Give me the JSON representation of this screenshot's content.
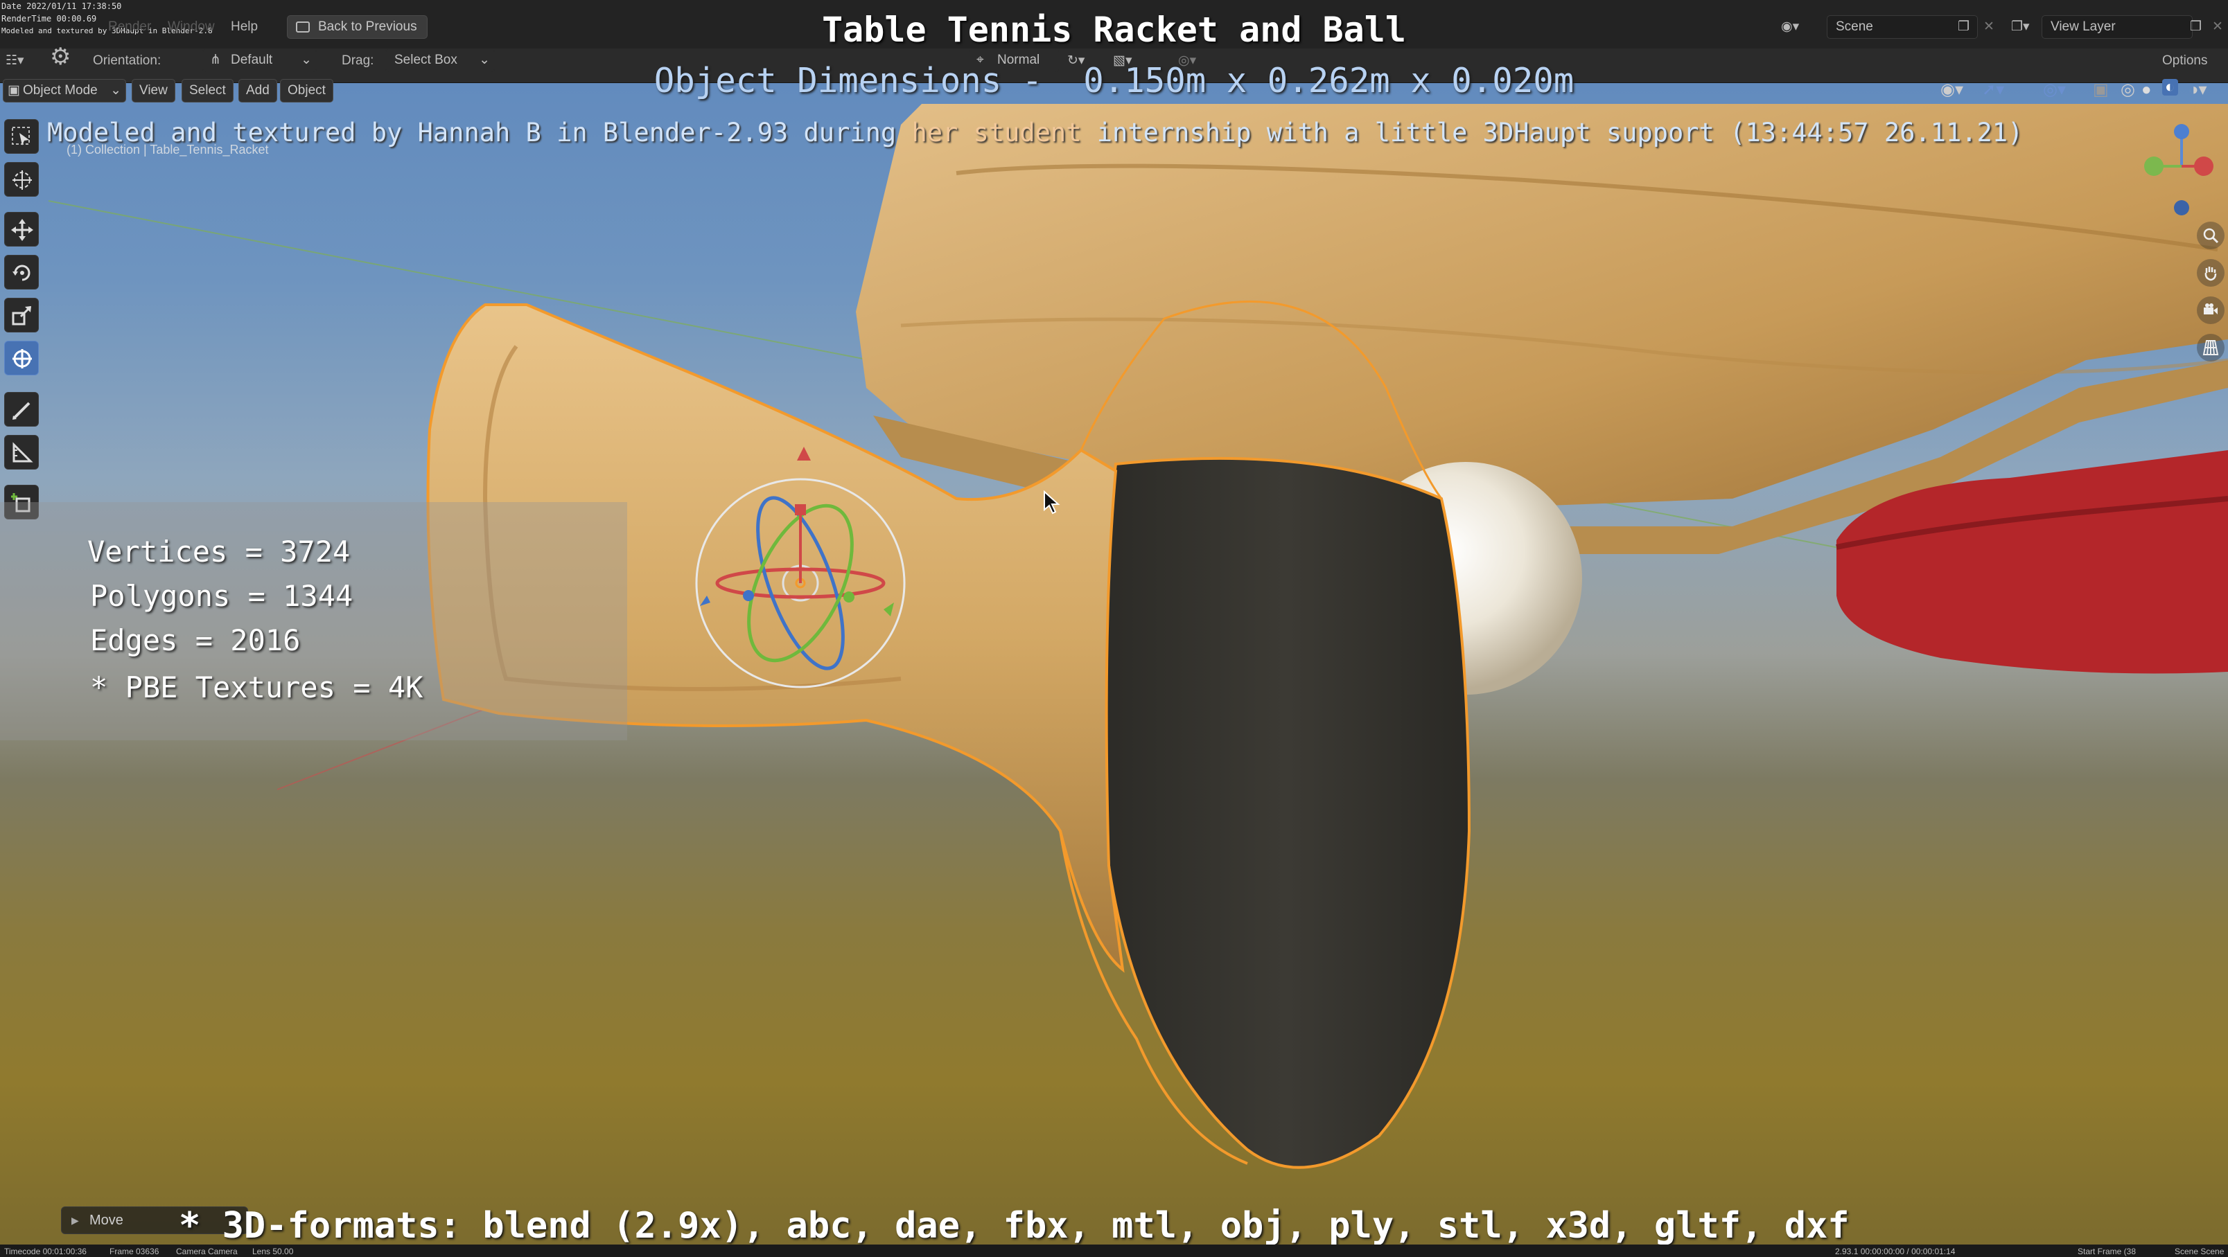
{
  "overlay": {
    "title": "Table Tennis Racket and Ball",
    "dimensions": "Object Dimensions -  0.150m x 0.262m x 0.020m",
    "credit_part1": "Modeled and textured by Hannah B in Blender-2.93 during ",
    "credit_highlight": "her student",
    "credit_part2": " internship with a little 3DHaupt support (13:44:57 26.11.21)",
    "collection_path": "(1) Collection | Table_Tennis_Racket"
  },
  "stats": {
    "vertices": "Vertices = 3724",
    "polygons": "Polygons = 1344",
    "edges": "Edges = 2016",
    "textures": "* PBE Textures = 4K"
  },
  "formats_line": "* 3D-formats: blend (2.9x), abc, dae, fbx, mtl, obj, ply, stl, x3d, gltf, dxf",
  "corner_info": {
    "date": "Date 2022/01/11 17:38:50",
    "render_time": "RenderTime 00:00.69",
    "modeled_by": "Modeled and textured by 3DHaupt in Blender-2.8"
  },
  "topbar": {
    "menu": [
      "Render",
      "Window",
      "Help"
    ],
    "back_button": "Back to Previous",
    "scene_label": "Scene",
    "view_layer_label": "View Layer"
  },
  "tool_header": {
    "orientation_label": "Orientation:",
    "orientation_value": "Default",
    "drag_label": "Drag:",
    "drag_value": "Select Box",
    "pivot_value": "Normal",
    "options_label": "Options"
  },
  "viewport_header": {
    "mode": "Object Mode",
    "menus": [
      "View",
      "Select",
      "Add",
      "Object"
    ]
  },
  "last_operator": "Move",
  "status_bar": {
    "timecode": "Timecode 00:01:00:36",
    "frame": "Frame 03636",
    "camera": "Camera Camera",
    "lens": "Lens 50.00",
    "version": "2.93.1  00:00:00:00 / 00:00:01:14",
    "start_frame": "Start Frame (38",
    "scene_scene": "Scene Scene"
  },
  "colors": {
    "accent_blue": "#4772b3",
    "selection_orange": "#f39a2c",
    "rubber_red": "#b4262a",
    "ui_dark": "#232323"
  }
}
